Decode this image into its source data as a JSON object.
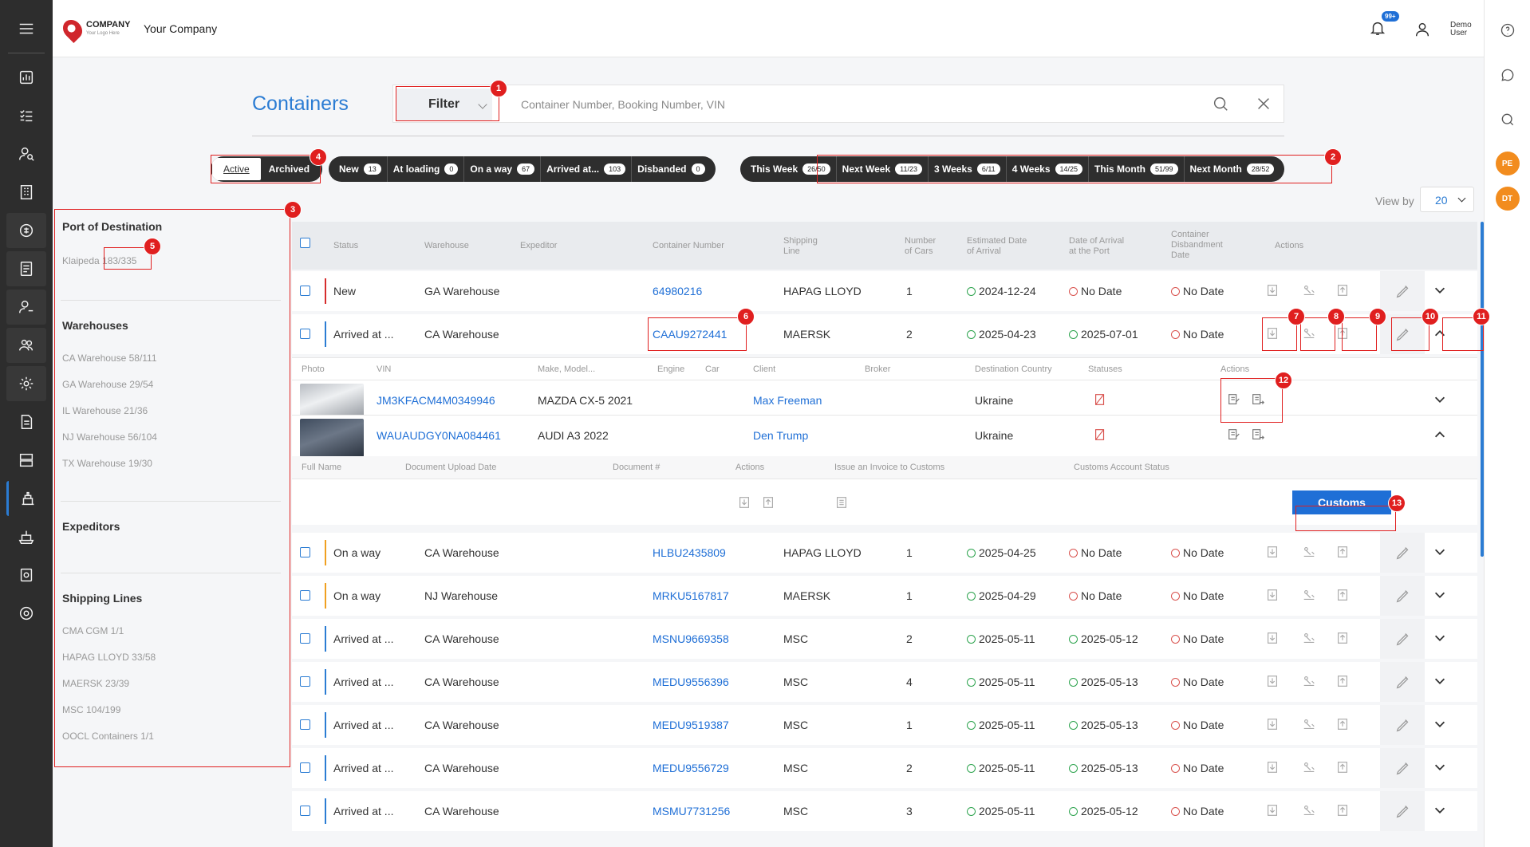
{
  "app": {
    "logo_text": "COMPANY",
    "logo_sub": "Your Logo Here",
    "company": "Your Company",
    "notif_badge": "99+",
    "user_line1": "Demo",
    "user_line2": "User"
  },
  "rail": {
    "avatar1": "PE",
    "avatar2": "DT"
  },
  "page": {
    "title": "Containers"
  },
  "filter": {
    "label": "Filter",
    "placeholder": "Container Number, Booking Number, VIN"
  },
  "tabs": {
    "active": "Active",
    "archived": "Archived"
  },
  "status_pills": [
    {
      "label": "New",
      "count": "13"
    },
    {
      "label": "At loading",
      "count": "0"
    },
    {
      "label": "On a way",
      "count": "67"
    },
    {
      "label": "Arrived at...",
      "count": "103"
    },
    {
      "label": "Disbanded",
      "count": "0"
    }
  ],
  "time_pills": [
    {
      "label": "This Week",
      "count": "26/50"
    },
    {
      "label": "Next Week",
      "count": "11/23"
    },
    {
      "label": "3 Weeks",
      "count": "6/11"
    },
    {
      "label": "4 Weeks",
      "count": "14/25"
    },
    {
      "label": "This Month",
      "count": "51/99"
    },
    {
      "label": "Next Month",
      "count": "28/52"
    }
  ],
  "view_by": {
    "label": "View by",
    "value": "20"
  },
  "side": {
    "port_title": "Port of Destination",
    "port_items": [
      "Klaipeda 183/335"
    ],
    "wh_title": "Warehouses",
    "wh_items": [
      "CA Warehouse 58/111",
      "GA Warehouse 29/54",
      "IL Warehouse 21/36",
      "NJ Warehouse 56/104",
      "TX Warehouse 19/30"
    ],
    "exp_title": "Expeditors",
    "sl_title": "Shipping Lines",
    "sl_items": [
      "CMA CGM 1/1",
      "HAPAG LLOYD 33/58",
      "MAERSK 23/39",
      "MSC 104/199",
      "OOCL Containers 1/1"
    ]
  },
  "columns": {
    "status": "Status",
    "warehouse": "Warehouse",
    "expeditor": "Expeditor",
    "container": "Container Number",
    "ship1": "Shipping",
    "ship2": "Line",
    "cars1": "Number",
    "cars2": "of Cars",
    "eta1": "Estimated Date",
    "eta2": "of Arrival",
    "port1": "Date of Arrival",
    "port2": "at the Port",
    "dis1": "Container",
    "dis2": "Disbandment",
    "dis3": "Date",
    "actions": "Actions"
  },
  "rows": [
    {
      "status": "New",
      "warehouse": "GA Warehouse",
      "container": "64980216",
      "line": "HAPAG LLOYD",
      "cars": "1",
      "eta": "2024-12-24",
      "port": "No Date",
      "dis": "No Date",
      "color": "#d62d2d"
    },
    {
      "status": "Arrived at ...",
      "warehouse": "CA Warehouse",
      "container": "CAAU9272441",
      "line": "MAERSK",
      "cars": "2",
      "eta": "2025-04-23",
      "port": "2025-07-01",
      "dis": "No Date",
      "color": "#2b7cd3"
    }
  ],
  "car_columns": {
    "photo": "Photo",
    "vin": "VIN",
    "make": "Make, Model...",
    "engine": "Engine",
    "car": "Car",
    "client": "Client",
    "broker": "Broker",
    "dest": "Destination Country",
    "statuses": "Statuses",
    "actions": "Actions"
  },
  "cars": [
    {
      "vin": "JM3KFACM4M0349946",
      "make": "MAZDA CX-5 2021",
      "client": "Max Freeman",
      "country": "Ukraine"
    },
    {
      "vin": "WAUAUDGY0NA084461",
      "make": "AUDI A3 2022",
      "client": "Den Trump",
      "country": "Ukraine"
    }
  ],
  "doc_columns": {
    "name": "Full Name",
    "upload": "Document Upload Date",
    "num": "Document #",
    "actions": "Actions",
    "invoice": "Issue an Invoice to Customs",
    "status": "Customs Account Status"
  },
  "customs_button": "Customs",
  "rows2": [
    {
      "status": "On a way",
      "warehouse": "CA Warehouse",
      "container": "HLBU2435809",
      "line": "HAPAG LLOYD",
      "cars": "1",
      "eta": "2025-04-25",
      "port": "No Date",
      "dis": "No Date",
      "color": "#f0a020"
    },
    {
      "status": "On a way",
      "warehouse": "NJ Warehouse",
      "container": "MRKU5167817",
      "line": "MAERSK",
      "cars": "1",
      "eta": "2025-04-29",
      "port": "No Date",
      "dis": "No Date",
      "color": "#f0a020"
    },
    {
      "status": "Arrived at ...",
      "warehouse": "CA Warehouse",
      "container": "MSNU9669358",
      "line": "MSC",
      "cars": "2",
      "eta": "2025-05-11",
      "port": "2025-05-12",
      "dis": "No Date",
      "color": "#2b7cd3"
    },
    {
      "status": "Arrived at ...",
      "warehouse": "CA Warehouse",
      "container": "MEDU9556396",
      "line": "MSC",
      "cars": "4",
      "eta": "2025-05-11",
      "port": "2025-05-13",
      "dis": "No Date",
      "color": "#2b7cd3"
    },
    {
      "status": "Arrived at ...",
      "warehouse": "CA Warehouse",
      "container": "MEDU9519387",
      "line": "MSC",
      "cars": "1",
      "eta": "2025-05-11",
      "port": "2025-05-13",
      "dis": "No Date",
      "color": "#2b7cd3"
    },
    {
      "status": "Arrived at ...",
      "warehouse": "CA Warehouse",
      "container": "MEDU9556729",
      "line": "MSC",
      "cars": "2",
      "eta": "2025-05-11",
      "port": "2025-05-13",
      "dis": "No Date",
      "color": "#2b7cd3"
    },
    {
      "status": "Arrived at ...",
      "warehouse": "CA Warehouse",
      "container": "MSMU7731256",
      "line": "MSC",
      "cars": "3",
      "eta": "2025-05-11",
      "port": "2025-05-12",
      "dis": "No Date",
      "color": "#2b7cd3"
    }
  ],
  "markers": [
    "1",
    "2",
    "3",
    "4",
    "5",
    "6",
    "7",
    "8",
    "9",
    "10",
    "11",
    "12",
    "13"
  ]
}
